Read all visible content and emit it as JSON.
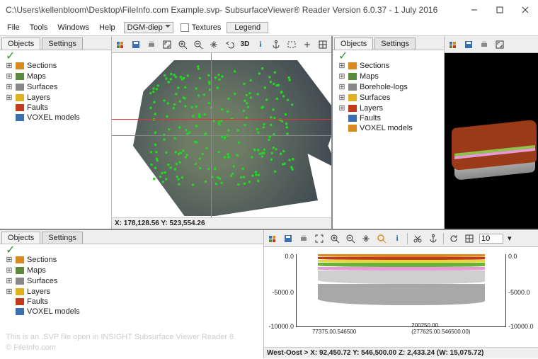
{
  "title": "C:\\Users\\kellenbloom\\Desktop\\FileInfo.com Example.svp- SubsurfaceViewer® Reader Version 6.0.37 - 1 July 2016",
  "menu": {
    "file": "File",
    "tools": "Tools",
    "windows": "Windows",
    "help": "Help",
    "combo_value": "DGM-diep",
    "textures_label": "Textures",
    "legend_label": "Legend"
  },
  "tabs": {
    "objects": "Objects",
    "settings": "Settings"
  },
  "tree": {
    "top_left": [
      "Sections",
      "Maps",
      "Surfaces",
      "Layers",
      "Faults",
      "VOXEL models"
    ],
    "top_right": [
      "Sections",
      "Maps",
      "Borehole-logs",
      "Surfaces",
      "Layers",
      "Faults",
      "VOXEL models"
    ],
    "bottom_left": [
      "Sections",
      "Maps",
      "Surfaces",
      "Layers",
      "Faults",
      "VOXEL models"
    ]
  },
  "map_view": {
    "status": "X: 178,128.56 Y: 523,554.26"
  },
  "main_toolbar": {
    "icons": [
      "window-icon",
      "save-icon",
      "print-icon",
      "fit-icon",
      "zoom-in-icon",
      "zoom-out-icon",
      "pan-icon",
      "undo-icon",
      "3d-icon",
      "info-icon",
      "anchor-icon",
      "rect-select-icon",
      "plus-icon",
      "grid-icon"
    ]
  },
  "side3d_toolbar": {
    "icons": [
      "window-icon",
      "save-icon",
      "print-icon",
      "fit-icon"
    ]
  },
  "section_toolbar": {
    "icons_a": [
      "window-icon",
      "save-icon",
      "print-icon",
      "fit-expand-icon",
      "zoom-in-icon",
      "zoom-out-icon",
      "pan-icon",
      "zoom-reset-icon",
      "info-icon"
    ],
    "icons_b": [
      "scissors-icon",
      "anchor-icon"
    ],
    "icons_c": [
      "refresh-icon",
      "grid-icon"
    ],
    "spinner_value": "10"
  },
  "chart_data": {
    "type": "area",
    "title": "",
    "xlabel": "",
    "ylabel": "",
    "ylim": [
      -10000,
      0
    ],
    "y_ticks": [
      0,
      -5000,
      -10000
    ],
    "x_ticks": [
      "77375.00.546500",
      "200250.00 (277625.00.546500.00)"
    ],
    "series": [
      {
        "name": "surface-orange",
        "color": "#d88a1e",
        "top": 0,
        "thickness": 400
      },
      {
        "name": "red",
        "color": "#c23a1a",
        "top": -400,
        "thickness": 400
      },
      {
        "name": "yellow",
        "color": "#e6d93a",
        "top": -800,
        "thickness": 400
      },
      {
        "name": "green",
        "color": "#6cb23a",
        "top": -1200,
        "thickness": 600
      },
      {
        "name": "pink",
        "color": "#e89ad6",
        "top": -1800,
        "thickness": 500
      },
      {
        "name": "light-grey",
        "color": "#cfcfcf",
        "top": -2300,
        "thickness": 1800
      },
      {
        "name": "grey",
        "color": "#a8a8a8",
        "top": -4100,
        "thickness": 3000
      }
    ]
  },
  "section_view": {
    "status": "West-Oost  >  X: 92,450.72 Y: 546,500.00 Z: 2,433.24 (W: 15,075.72)",
    "y_labels": {
      "0": "0.0",
      "mid": "-5000.0",
      "bot": "-10000.0"
    }
  },
  "watermark": {
    "l1": "This is an .SVP file open in INSIGHT Subsurface Viewer Reader 6.",
    "l2": "© FileInfo.com"
  }
}
